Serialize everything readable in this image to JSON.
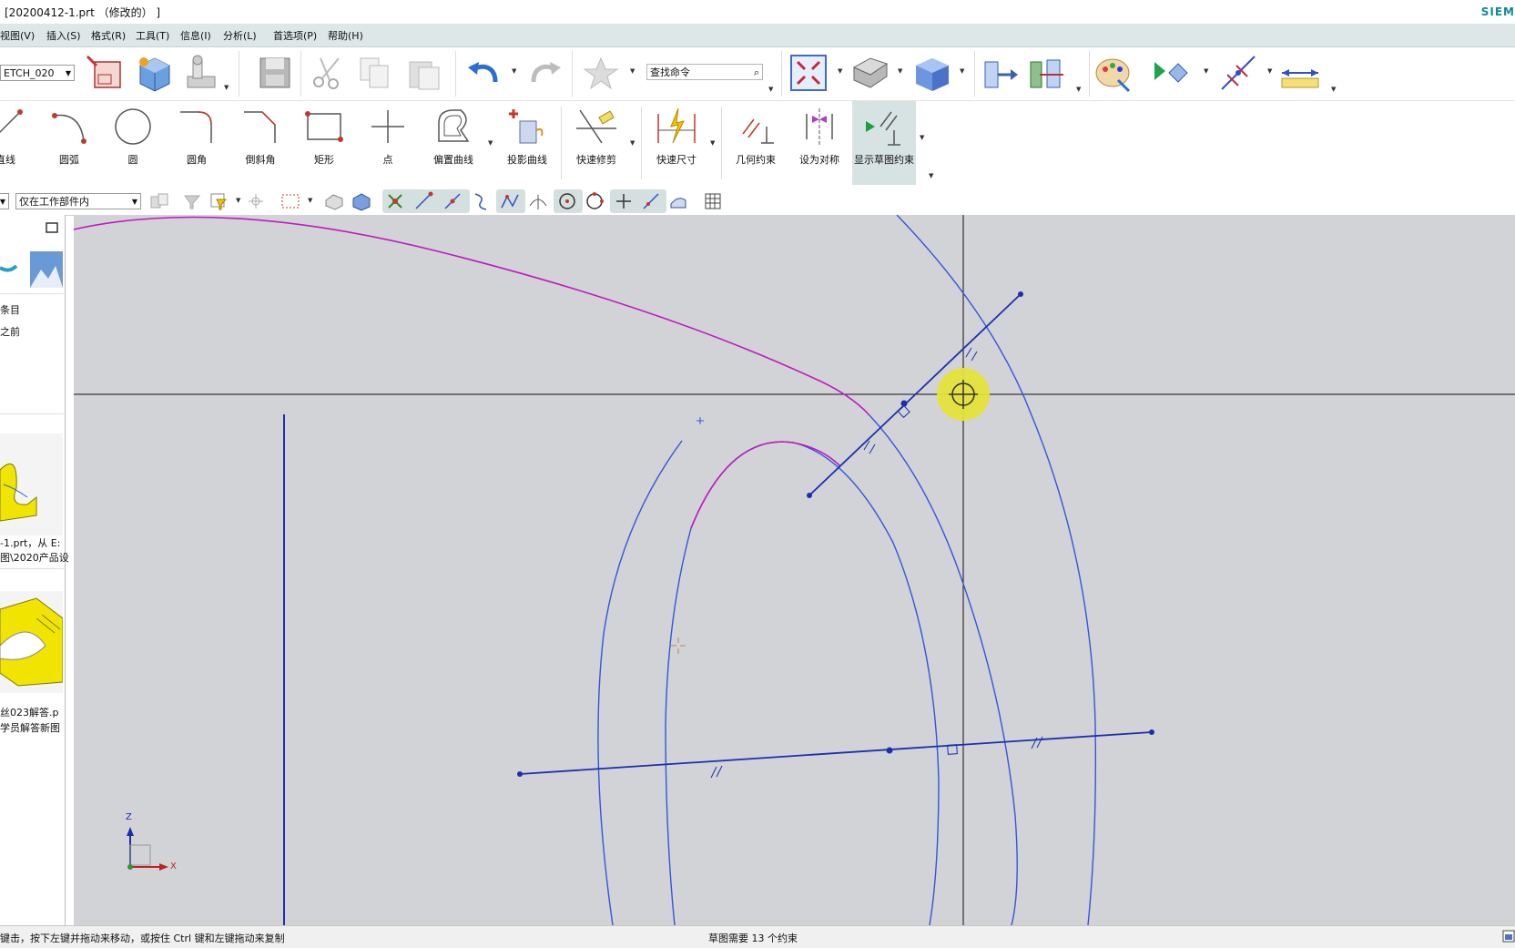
{
  "window": {
    "title": "[20200412-1.prt （修改的） ]",
    "brand": "SIEM"
  },
  "menu": [
    "视图(V)",
    "插入(S)",
    "格式(R)",
    "工具(T)",
    "信息(I)",
    "分析(L)",
    "首选项(P)",
    "帮助(H)"
  ],
  "toolbar": {
    "sketch_combo": "ETCH_020",
    "search_placeholder": "查找命令"
  },
  "sketch_tools": [
    {
      "label": "直线"
    },
    {
      "label": "圆弧"
    },
    {
      "label": "圆"
    },
    {
      "label": "圆角"
    },
    {
      "label": "倒斜角"
    },
    {
      "label": "矩形"
    },
    {
      "label": "点"
    },
    {
      "label": "偏置曲线"
    },
    {
      "label": "投影曲线"
    },
    {
      "label": "快速修剪"
    },
    {
      "label": "快速尺寸"
    },
    {
      "label": "几何约束"
    },
    {
      "label": "设为对称"
    },
    {
      "label": "显示草图约束"
    }
  ],
  "selection": {
    "scope_combo": "仅在工作部件内"
  },
  "left_panel": {
    "item1": "条目",
    "item2": "之前",
    "recent1_line1": "-1.prt，从 E:",
    "recent1_line2": "图\\2020产品设",
    "recent2_line1": "丝023解答.p",
    "recent2_line2": "学员解答新图"
  },
  "status": {
    "hint": "键击，按下左键并拖动来移动，或按住 Ctrl 键和左键拖动来复制",
    "center": "草图需要 13 个约束"
  },
  "colors": {
    "canvas": "#d2d3d6",
    "curve": "#3355dd",
    "line": "#1a2fb0",
    "magenta": "#c218c2",
    "cursor": "#e5e23a",
    "menubar": "#dde7e7"
  },
  "axes": {
    "z": "Z",
    "x": "X"
  }
}
